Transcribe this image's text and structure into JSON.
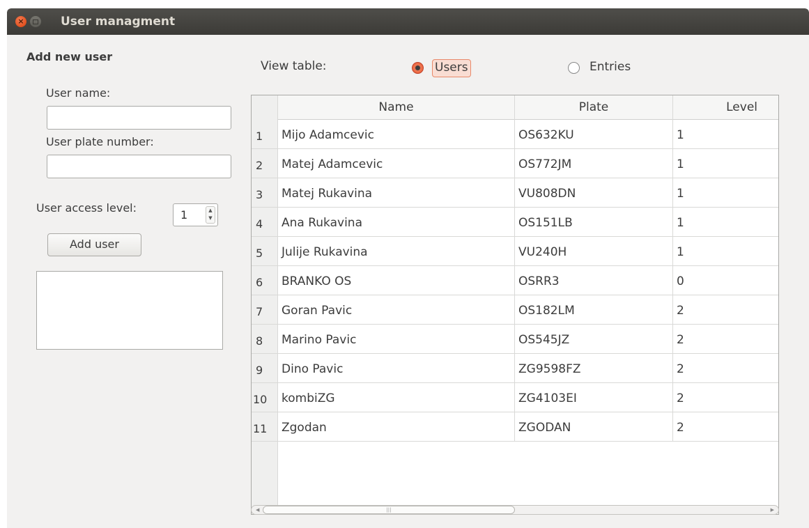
{
  "window": {
    "title": "User managment"
  },
  "form": {
    "section_title": "Add new user",
    "name_label": "User name:",
    "name_value": "",
    "plate_label": "User plate number:",
    "plate_value": "",
    "level_label": "User access level:",
    "level_value": "1",
    "add_button_label": "Add user",
    "log_text": ""
  },
  "view": {
    "label": "View table:",
    "options": [
      {
        "label": "Users",
        "selected": true
      },
      {
        "label": "Entries",
        "selected": false
      }
    ]
  },
  "table": {
    "columns": [
      "Name",
      "Plate",
      "Level"
    ],
    "rows": [
      {
        "num": "1",
        "name": "Mijo Adamcevic",
        "plate": "OS632KU",
        "level": "1"
      },
      {
        "num": "2",
        "name": "Matej Adamcevic",
        "plate": "OS772JM",
        "level": "1"
      },
      {
        "num": "3",
        "name": "Matej Rukavina",
        "plate": "VU808DN",
        "level": "1"
      },
      {
        "num": "4",
        "name": "Ana Rukavina",
        "plate": "OS151LB",
        "level": "1"
      },
      {
        "num": "5",
        "name": "Julije Rukavina",
        "plate": "VU240H",
        "level": "1"
      },
      {
        "num": "6",
        "name": "BRANKO OS",
        "plate": "OSRR3",
        "level": "0"
      },
      {
        "num": "7",
        "name": "Goran Pavic",
        "plate": "OS182LM",
        "level": "2"
      },
      {
        "num": "8",
        "name": "Marino Pavic",
        "plate": "OS545JZ",
        "level": "2"
      },
      {
        "num": "9",
        "name": "Dino Pavic",
        "plate": "ZG9598FZ",
        "level": "2"
      },
      {
        "num": "10",
        "name": "kombiZG",
        "plate": "ZG4103EI",
        "level": "2"
      },
      {
        "num": "11",
        "name": "Zgodan",
        "plate": "ZGODAN",
        "level": "2"
      }
    ]
  },
  "colors": {
    "titlebar": "#3c3b37",
    "accent": "#e9623c"
  },
  "icons": {
    "close": "close-icon",
    "maximize": "maximize-icon"
  }
}
